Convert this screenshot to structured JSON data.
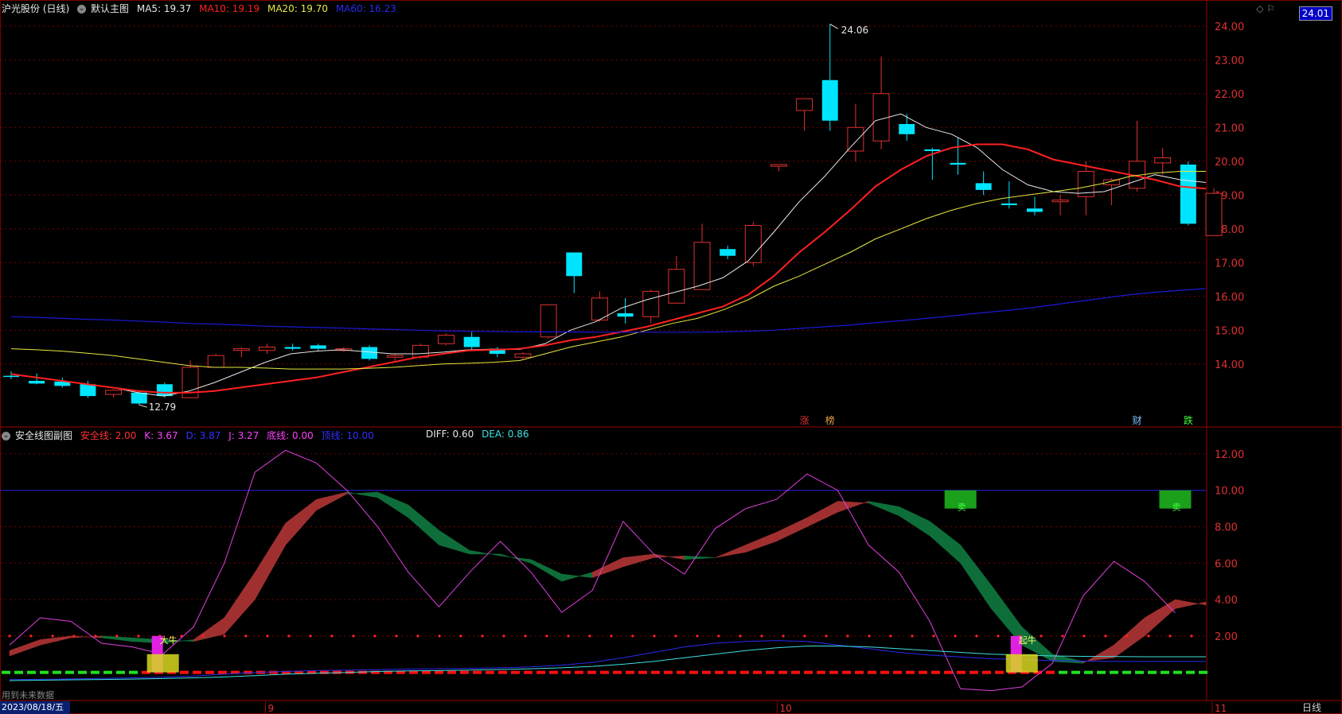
{
  "header": {
    "stock_label": "沪光股份 (日线)",
    "main_chart_label": "默认主图",
    "ma5": "MA5: 19.37",
    "ma10": "MA10: 19.19",
    "ma20": "MA20: 19.70",
    "ma60": "MA60: 16.23"
  },
  "sub_header": {
    "label": "安全线图副图",
    "safe_line": "安全线: 2.00",
    "k": "K: 3.67",
    "d": "D: 3.87",
    "j": "J: 3.27",
    "bottom_line": "底线: 0.00",
    "top_line": "顶线: 10.00",
    "diff": "DIFF: 0.60",
    "dea": "DEA: 0.86"
  },
  "price_badge": "24.01",
  "bottom": {
    "date_tab": "2023/08/18/五",
    "period": "日线",
    "no_data_text": "用到未来数据"
  },
  "colors": {
    "up": "#e03030",
    "down": "#00e5ff",
    "ma5": "#e8e8e8",
    "ma10": "#ff2020",
    "ma20": "#e8e840",
    "ma60": "#1a1ad8",
    "grid": "#7a0000",
    "band_up": "#a03030",
    "band_down": "#0e6e3a",
    "j_line": "#e040e0"
  },
  "chart_data": [
    {
      "type": "candlestick",
      "y_axis_ticks": [
        14.0,
        15.0,
        16.0,
        17.0,
        18.0,
        19.0,
        20.0,
        21.0,
        22.0,
        23.0,
        24.0
      ],
      "ylim": [
        12.3,
        24.3
      ],
      "x_tick_labels": [
        "9",
        "10",
        "11"
      ],
      "x_tick_index": [
        10,
        30,
        47
      ],
      "candles": [
        {
          "o": 13.65,
          "h": 13.78,
          "l": 13.55,
          "c": 13.62
        },
        {
          "o": 13.5,
          "h": 13.72,
          "l": 13.4,
          "c": 13.42
        },
        {
          "o": 13.48,
          "h": 13.6,
          "l": 13.3,
          "c": 13.35
        },
        {
          "o": 13.4,
          "h": 13.5,
          "l": 13.0,
          "c": 13.05
        },
        {
          "o": 13.1,
          "h": 13.25,
          "l": 13.0,
          "c": 13.22
        },
        {
          "o": 13.15,
          "h": 13.2,
          "l": 12.79,
          "c": 12.83
        },
        {
          "o": 13.4,
          "h": 13.45,
          "l": 13.0,
          "c": 13.05
        },
        {
          "o": 13.0,
          "h": 14.1,
          "l": 12.98,
          "c": 13.9
        },
        {
          "o": 13.9,
          "h": 14.3,
          "l": 13.9,
          "c": 14.25
        },
        {
          "o": 14.4,
          "h": 14.5,
          "l": 14.2,
          "c": 14.45
        },
        {
          "o": 14.4,
          "h": 14.6,
          "l": 14.3,
          "c": 14.5
        },
        {
          "o": 14.5,
          "h": 14.6,
          "l": 14.4,
          "c": 14.45
        },
        {
          "o": 14.55,
          "h": 14.6,
          "l": 14.4,
          "c": 14.45
        },
        {
          "o": 14.4,
          "h": 14.5,
          "l": 14.35,
          "c": 14.45
        },
        {
          "o": 14.5,
          "h": 14.55,
          "l": 14.1,
          "c": 14.15
        },
        {
          "o": 14.2,
          "h": 14.3,
          "l": 14.1,
          "c": 14.25
        },
        {
          "o": 14.2,
          "h": 14.6,
          "l": 14.15,
          "c": 14.55
        },
        {
          "o": 14.6,
          "h": 14.9,
          "l": 14.55,
          "c": 14.85
        },
        {
          "o": 14.8,
          "h": 14.95,
          "l": 14.4,
          "c": 14.5
        },
        {
          "o": 14.45,
          "h": 14.5,
          "l": 14.2,
          "c": 14.3
        },
        {
          "o": 14.2,
          "h": 14.35,
          "l": 14.15,
          "c": 14.3
        },
        {
          "o": 14.8,
          "h": 15.75,
          "l": 14.75,
          "c": 15.75
        },
        {
          "o": 17.3,
          "h": 17.3,
          "l": 16.1,
          "c": 16.6
        },
        {
          "o": 15.3,
          "h": 16.15,
          "l": 15.25,
          "c": 15.95
        },
        {
          "o": 15.5,
          "h": 15.95,
          "l": 15.2,
          "c": 15.4
        },
        {
          "o": 15.4,
          "h": 16.2,
          "l": 15.2,
          "c": 16.15
        },
        {
          "o": 15.8,
          "h": 17.2,
          "l": 15.8,
          "c": 16.8
        },
        {
          "o": 16.2,
          "h": 18.15,
          "l": 16.2,
          "c": 17.6
        },
        {
          "o": 17.4,
          "h": 17.5,
          "l": 17.1,
          "c": 17.2
        },
        {
          "o": 17.0,
          "h": 18.2,
          "l": 16.9,
          "c": 18.1
        },
        {
          "o": 19.85,
          "h": 19.9,
          "l": 19.7,
          "c": 19.9
        },
        {
          "o": 21.5,
          "h": 21.85,
          "l": 20.9,
          "c": 21.85
        },
        {
          "o": 22.4,
          "h": 24.06,
          "l": 20.9,
          "c": 21.2
        },
        {
          "o": 20.3,
          "h": 21.7,
          "l": 20.0,
          "c": 21.0
        },
        {
          "o": 20.6,
          "h": 23.1,
          "l": 20.35,
          "c": 22.0
        },
        {
          "o": 21.1,
          "h": 21.4,
          "l": 20.6,
          "c": 20.8
        },
        {
          "o": 20.35,
          "h": 20.4,
          "l": 19.45,
          "c": 20.3
        },
        {
          "o": 19.95,
          "h": 20.7,
          "l": 19.6,
          "c": 19.9
        },
        {
          "o": 19.35,
          "h": 19.7,
          "l": 19.0,
          "c": 19.15
        },
        {
          "o": 18.75,
          "h": 19.4,
          "l": 18.6,
          "c": 18.7
        },
        {
          "o": 18.6,
          "h": 18.95,
          "l": 18.4,
          "c": 18.5
        },
        {
          "o": 18.8,
          "h": 19.0,
          "l": 18.4,
          "c": 18.85
        },
        {
          "o": 18.95,
          "h": 20.0,
          "l": 18.4,
          "c": 19.7
        },
        {
          "o": 19.3,
          "h": 19.5,
          "l": 18.7,
          "c": 19.45
        },
        {
          "o": 19.2,
          "h": 21.2,
          "l": 19.1,
          "c": 20.0
        },
        {
          "o": 19.95,
          "h": 20.4,
          "l": 19.6,
          "c": 20.1
        },
        {
          "o": 19.9,
          "h": 20.0,
          "l": 18.1,
          "c": 18.15
        },
        {
          "o": 17.8,
          "h": 19.2,
          "l": 17.8,
          "c": 19.05
        }
      ],
      "high_label": "24.06",
      "low_label": "12.79",
      "series": [
        {
          "name": "MA5",
          "values": [
            13.7,
            13.6,
            13.5,
            13.4,
            13.3,
            13.15,
            13.05,
            13.2,
            13.45,
            13.75,
            14.05,
            14.3,
            14.38,
            14.42,
            14.36,
            14.3,
            14.3,
            14.35,
            14.42,
            14.44,
            14.43,
            14.6,
            15.0,
            15.25,
            15.65,
            15.9,
            16.1,
            16.3,
            16.55,
            17.05,
            17.9,
            18.8,
            19.55,
            20.4,
            21.2,
            21.4,
            21.0,
            20.8,
            20.4,
            19.75,
            19.3,
            19.1,
            19.05,
            19.1,
            19.35,
            19.6,
            19.45,
            19.37
          ]
        },
        {
          "name": "MA10",
          "values": [
            13.7,
            13.6,
            13.5,
            13.4,
            13.3,
            13.2,
            13.15,
            13.15,
            13.2,
            13.3,
            13.4,
            13.5,
            13.6,
            13.75,
            13.9,
            14.05,
            14.2,
            14.3,
            14.4,
            14.42,
            14.45,
            14.55,
            14.7,
            14.8,
            14.95,
            15.1,
            15.3,
            15.5,
            15.7,
            16.05,
            16.6,
            17.3,
            17.9,
            18.55,
            19.25,
            19.75,
            20.15,
            20.4,
            20.5,
            20.5,
            20.35,
            20.05,
            19.9,
            19.75,
            19.6,
            19.45,
            19.25,
            19.19
          ]
        },
        {
          "name": "MA20",
          "values": [
            14.45,
            14.42,
            14.38,
            14.32,
            14.25,
            14.15,
            14.05,
            13.95,
            13.9,
            13.9,
            13.88,
            13.85,
            13.85,
            13.85,
            13.87,
            13.9,
            13.95,
            14.0,
            14.02,
            14.05,
            14.1,
            14.3,
            14.5,
            14.65,
            14.8,
            15.0,
            15.2,
            15.35,
            15.6,
            15.9,
            16.3,
            16.6,
            16.95,
            17.3,
            17.7,
            18.0,
            18.3,
            18.55,
            18.75,
            18.9,
            19.0,
            19.1,
            19.2,
            19.35,
            19.55,
            19.65,
            19.7,
            19.7
          ]
        },
        {
          "name": "MA60",
          "values": [
            15.4,
            15.38,
            15.35,
            15.32,
            15.3,
            15.27,
            15.24,
            15.2,
            15.18,
            15.15,
            15.12,
            15.1,
            15.08,
            15.06,
            15.04,
            15.02,
            15.0,
            14.98,
            14.97,
            14.96,
            14.95,
            14.95,
            14.95,
            14.94,
            14.94,
            14.94,
            14.94,
            14.94,
            14.95,
            14.97,
            15.0,
            15.05,
            15.1,
            15.15,
            15.22,
            15.28,
            15.35,
            15.42,
            15.5,
            15.57,
            15.65,
            15.75,
            15.85,
            15.95,
            16.05,
            16.12,
            16.18,
            16.23
          ]
        }
      ],
      "markers": [
        {
          "index": 31,
          "text": "涨",
          "color": "#e03030"
        },
        {
          "index": 32,
          "text": "榜",
          "color": "#e8a040"
        },
        {
          "index": 44,
          "text": "财",
          "color": "#80c0ff"
        },
        {
          "index": 46,
          "text": "跌",
          "color": "#40ff40"
        }
      ]
    },
    {
      "type": "line",
      "y_axis_ticks": [
        2.0,
        4.0,
        6.0,
        8.0,
        10.0,
        12.0
      ],
      "ylim": [
        -1.5,
        13.0
      ],
      "series": [
        {
          "name": "K",
          "values": [
            1.2,
            1.8,
            2.0,
            1.9,
            1.7,
            1.6,
            1.8,
            3.0,
            5.5,
            8.2,
            9.5,
            9.9,
            9.6,
            8.5,
            7.0,
            6.5,
            6.5,
            6.0,
            5.0,
            5.5,
            6.3,
            6.5,
            6.2,
            6.3,
            7.0,
            7.7,
            8.5,
            9.4,
            9.3,
            8.6,
            7.5,
            6.0,
            3.5,
            1.5,
            0.6,
            0.5,
            1.5,
            3.0,
            4.0,
            3.7
          ]
        },
        {
          "name": "D",
          "values": [
            0.9,
            1.5,
            1.9,
            2.0,
            1.9,
            1.8,
            1.7,
            2.1,
            4.0,
            7.0,
            8.9,
            9.8,
            9.9,
            9.2,
            7.8,
            6.7,
            6.4,
            6.2,
            5.4,
            5.2,
            5.8,
            6.3,
            6.4,
            6.3,
            6.6,
            7.2,
            8.0,
            8.8,
            9.4,
            9.1,
            8.3,
            7.0,
            4.8,
            2.5,
            1.0,
            0.6,
            0.8,
            2.0,
            3.5,
            3.87
          ]
        },
        {
          "name": "J",
          "values": [
            1.5,
            3.0,
            2.8,
            1.6,
            1.4,
            1.0,
            2.5,
            6.0,
            11.0,
            12.2,
            11.5,
            10.0,
            8.0,
            5.5,
            3.6,
            5.5,
            7.2,
            5.5,
            3.3,
            4.5,
            8.3,
            6.5,
            5.4,
            7.9,
            9.0,
            9.5,
            10.9,
            10.0,
            7.0,
            5.5,
            2.8,
            -0.9,
            -1.0,
            -0.8,
            0.5,
            4.2,
            6.1,
            5.0,
            3.27
          ]
        },
        {
          "name": "DIFF",
          "values": [
            -0.4,
            -0.38,
            -0.36,
            -0.33,
            -0.3,
            -0.27,
            -0.2,
            -0.1,
            0.0,
            0.05,
            0.1,
            0.12,
            0.15,
            0.18,
            0.2,
            0.22,
            0.25,
            0.3,
            0.4,
            0.55,
            0.8,
            1.1,
            1.4,
            1.6,
            1.7,
            1.75,
            1.7,
            1.5,
            1.3,
            1.1,
            0.95,
            0.85,
            0.75,
            0.7,
            0.65,
            0.62,
            0.6,
            0.6,
            0.6,
            0.6
          ]
        },
        {
          "name": "DEA",
          "values": [
            -0.45,
            -0.43,
            -0.41,
            -0.39,
            -0.37,
            -0.34,
            -0.3,
            -0.25,
            -0.18,
            -0.1,
            -0.05,
            0.0,
            0.05,
            0.08,
            0.1,
            0.13,
            0.16,
            0.2,
            0.25,
            0.33,
            0.45,
            0.6,
            0.8,
            1.0,
            1.2,
            1.35,
            1.45,
            1.45,
            1.4,
            1.3,
            1.2,
            1.1,
            1.0,
            0.95,
            0.9,
            0.88,
            0.87,
            0.86,
            0.86,
            0.86
          ]
        }
      ],
      "reference_lines": [
        0.0,
        2.0,
        10.0
      ],
      "signals": [
        {
          "index": 5,
          "text": "大牛",
          "type": "bottom"
        },
        {
          "index": 31,
          "text": "卖",
          "type": "top"
        },
        {
          "index": 38,
          "text": "卖",
          "type": "top"
        },
        {
          "index": 33,
          "text": "起牛",
          "type": "bottom"
        }
      ]
    }
  ]
}
